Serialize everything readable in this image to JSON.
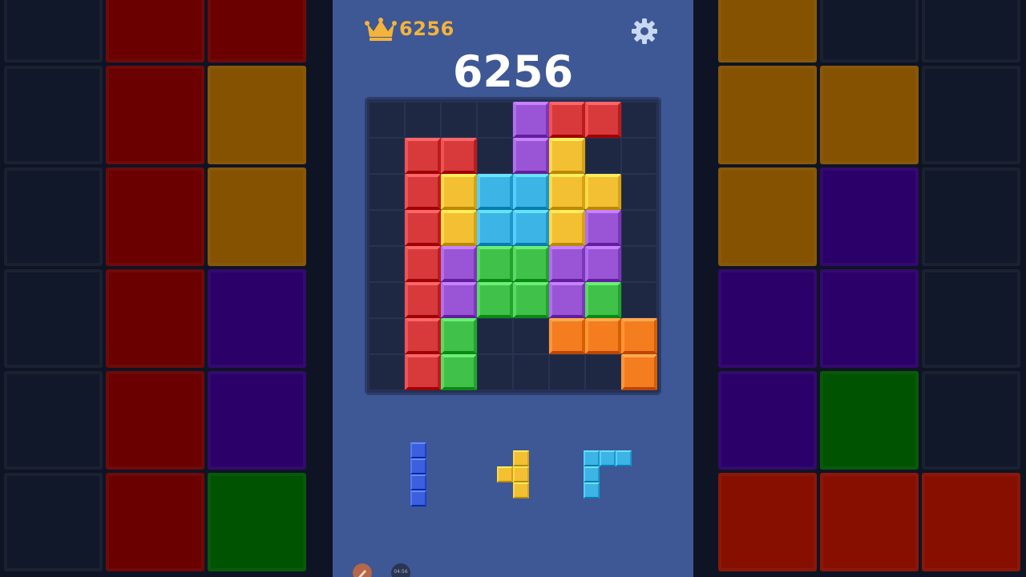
{
  "header": {
    "best_score": "6256",
    "crown_icon": "crown-icon",
    "settings_icon": "gear-icon"
  },
  "score": "6256",
  "colors": {
    "red": "#d8393b",
    "yellow": "#f2c032",
    "cyan": "#3cb5e6",
    "purple": "#9955d6",
    "green": "#3fc14a",
    "orange": "#f47d20",
    "blue": "#3c5fe0",
    "empty": "#1e2843"
  },
  "board": {
    "size": 8,
    "rows": [
      [
        "",
        "",
        "",
        "",
        "purple",
        "red",
        "red",
        ""
      ],
      [
        "",
        "red",
        "red",
        "",
        "purple",
        "yellow",
        "",
        ""
      ],
      [
        "",
        "red",
        "yellow",
        "cyan",
        "cyan",
        "yellow",
        "yellow",
        ""
      ],
      [
        "",
        "red",
        "yellow",
        "cyan",
        "cyan",
        "yellow",
        "purple",
        ""
      ],
      [
        "",
        "red",
        "purple",
        "green",
        "green",
        "purple",
        "purple",
        ""
      ],
      [
        "",
        "red",
        "purple",
        "green",
        "green",
        "purple",
        "green",
        ""
      ],
      [
        "",
        "red",
        "green",
        "",
        "",
        "orange",
        "orange",
        "orange"
      ],
      [
        "",
        "red",
        "green",
        "",
        "",
        "",
        "",
        "orange"
      ]
    ]
  },
  "pieces": [
    {
      "color": "blue",
      "shape": [
        [
          "1"
        ],
        [
          "1"
        ],
        [
          "1"
        ],
        [
          "1"
        ]
      ]
    },
    {
      "color": "yellow",
      "shape": [
        [
          "0",
          "1"
        ],
        [
          "1",
          "1"
        ],
        [
          "0",
          "1"
        ]
      ]
    },
    {
      "color": "cyan",
      "shape": [
        [
          "1",
          "1",
          "1"
        ],
        [
          "1",
          "0",
          "0"
        ],
        [
          "1",
          "0",
          "0"
        ]
      ]
    }
  ],
  "footer": {
    "timer": "04:56",
    "tool_icon": "brush-icon"
  }
}
